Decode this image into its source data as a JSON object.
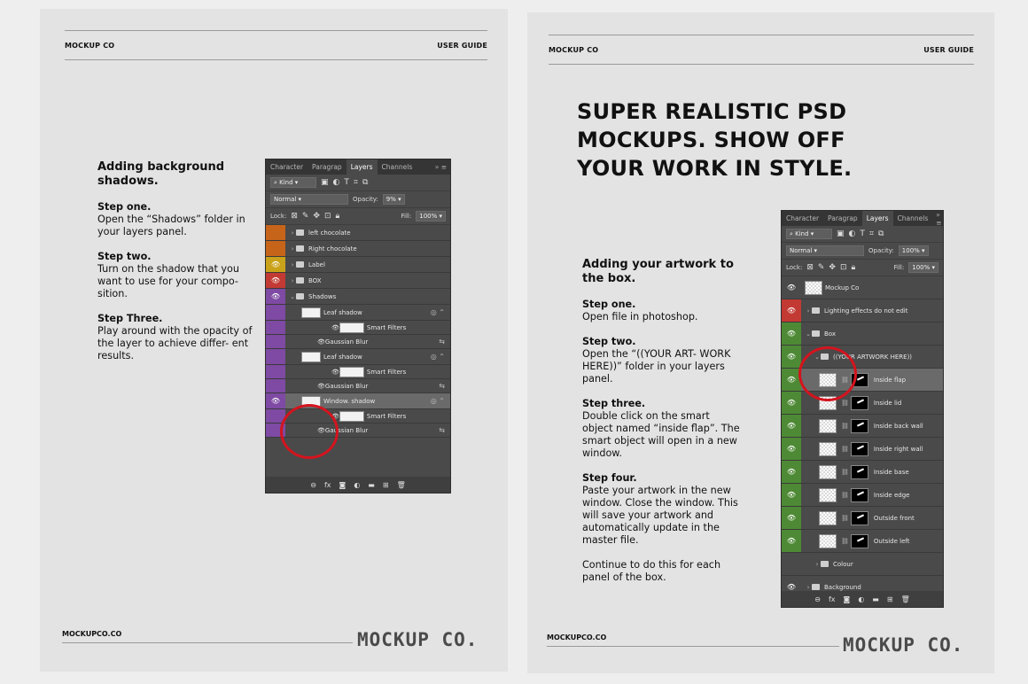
{
  "brand": "MOCKUP CO",
  "doc_label": "USER GUIDE",
  "footer_url": "MOCKUPCO.CO",
  "logo_text": "MOCKUP CO.",
  "colors": {
    "accent_red": "#d4141e",
    "orange": "#c6641a",
    "gold": "#c9a21a",
    "red": "#c23a33",
    "purple": "#7e4aa3",
    "green": "#4e8a35"
  },
  "left_page": {
    "title": "Adding background shadows.",
    "steps": [
      {
        "label": "Step one.",
        "text": "Open the “Shadows” folder in your layers panel."
      },
      {
        "label": "Step two.",
        "text": "Turn on the shadow that you want to use for your compo- sition."
      },
      {
        "label": "Step Three.",
        "text": "Play around with the opacity of the layer to achieve differ- ent results."
      }
    ]
  },
  "right_page": {
    "headline": [
      "SUPER REALISTIC PSD",
      "MOCKUPS. SHOW OFF",
      "YOUR WORK IN STYLE."
    ],
    "title": "Adding your artwork to the box.",
    "steps": [
      {
        "label": "Step one.",
        "text": "Open file in photoshop."
      },
      {
        "label": "Step two.",
        "text": "Open the “((YOUR ART- WORK HERE))” folder in your layers panel."
      },
      {
        "label": "Step three.",
        "text": "Double click on the smart object named “inside flap”. The smart object will open in a new window."
      },
      {
        "label": "Step four.",
        "text": "Paste your artwork in the new window. Close the window. This will save your artwork and automatically update in the master file."
      }
    ],
    "closing": "Continue to do this for each panel of the box."
  },
  "panel_a": {
    "tabs": [
      "Character",
      "Paragrap",
      "Layers",
      "Channels"
    ],
    "kind": "Kind",
    "blend": "Normal",
    "opacity_label": "Opacity:",
    "opacity_value": "9%",
    "lock_label": "Lock:",
    "fill_label": "Fill:",
    "fill_value": "100%",
    "layers": [
      {
        "name": "left chocolate",
        "type": "folder",
        "color": "orange",
        "eye": false
      },
      {
        "name": "Right chocolate",
        "type": "folder",
        "color": "orange",
        "eye": false
      },
      {
        "name": "Label",
        "type": "folder",
        "color": "gold",
        "eye": true
      },
      {
        "name": "BOX",
        "type": "folder",
        "color": "red",
        "eye": true
      },
      {
        "name": "Shadows",
        "type": "folder-open",
        "color": "purple",
        "eye": true
      },
      {
        "name": "Leaf shadow",
        "type": "smart",
        "color": "purple",
        "eye": false
      },
      {
        "name": "Smart Filters",
        "type": "filter",
        "color": "purple"
      },
      {
        "name": "Gaussian Blur",
        "type": "blur",
        "color": "purple"
      },
      {
        "name": "Leaf shadow",
        "type": "smart",
        "color": "purple",
        "eye": false
      },
      {
        "name": "Smart Filters",
        "type": "filter",
        "color": "purple"
      },
      {
        "name": "Gaussian Blur",
        "type": "blur",
        "color": "purple"
      },
      {
        "name": "Window. shadow",
        "type": "smart",
        "color": "purple",
        "eye": true,
        "selected": true
      },
      {
        "name": "Smart Filters",
        "type": "filter",
        "color": "purple"
      },
      {
        "name": "Gaussian Blur",
        "type": "blur",
        "color": "purple"
      }
    ]
  },
  "panel_b": {
    "tabs": [
      "Character",
      "Paragrap",
      "Layers",
      "Channels"
    ],
    "kind": "Kind",
    "blend": "Normal",
    "opacity_label": "Opacity:",
    "opacity_value": "100%",
    "lock_label": "Lock:",
    "fill_label": "Fill:",
    "fill_value": "100%",
    "layers": [
      {
        "name": "Mockup Co",
        "type": "image",
        "color": "none",
        "eye": true
      },
      {
        "name": "Lighting effects do not edit",
        "type": "folder",
        "color": "red",
        "eye": true
      },
      {
        "name": "Box",
        "type": "folder-open",
        "color": "green",
        "eye": true
      },
      {
        "name": "((YOUR ARTWORK HERE))",
        "type": "folder-open",
        "color": "green",
        "eye": true,
        "indent": 1
      },
      {
        "name": "Inside flap",
        "type": "masked",
        "color": "green",
        "eye": true,
        "selected": true
      },
      {
        "name": "Inside lid",
        "type": "masked",
        "color": "green",
        "eye": true
      },
      {
        "name": "Inside back wall",
        "type": "masked",
        "color": "green",
        "eye": true
      },
      {
        "name": "Inside right wall",
        "type": "masked",
        "color": "green",
        "eye": true
      },
      {
        "name": "Inside base",
        "type": "masked",
        "color": "green",
        "eye": true
      },
      {
        "name": "Inside edge",
        "type": "masked",
        "color": "green",
        "eye": true
      },
      {
        "name": "Outside front",
        "type": "masked",
        "color": "green",
        "eye": true
      },
      {
        "name": "Outside left",
        "type": "masked",
        "color": "green",
        "eye": true
      },
      {
        "name": "Colour",
        "type": "folder",
        "color": "none",
        "eye": false,
        "indent": 1
      },
      {
        "name": "Background",
        "type": "folder",
        "color": "none",
        "eye": true
      }
    ]
  }
}
